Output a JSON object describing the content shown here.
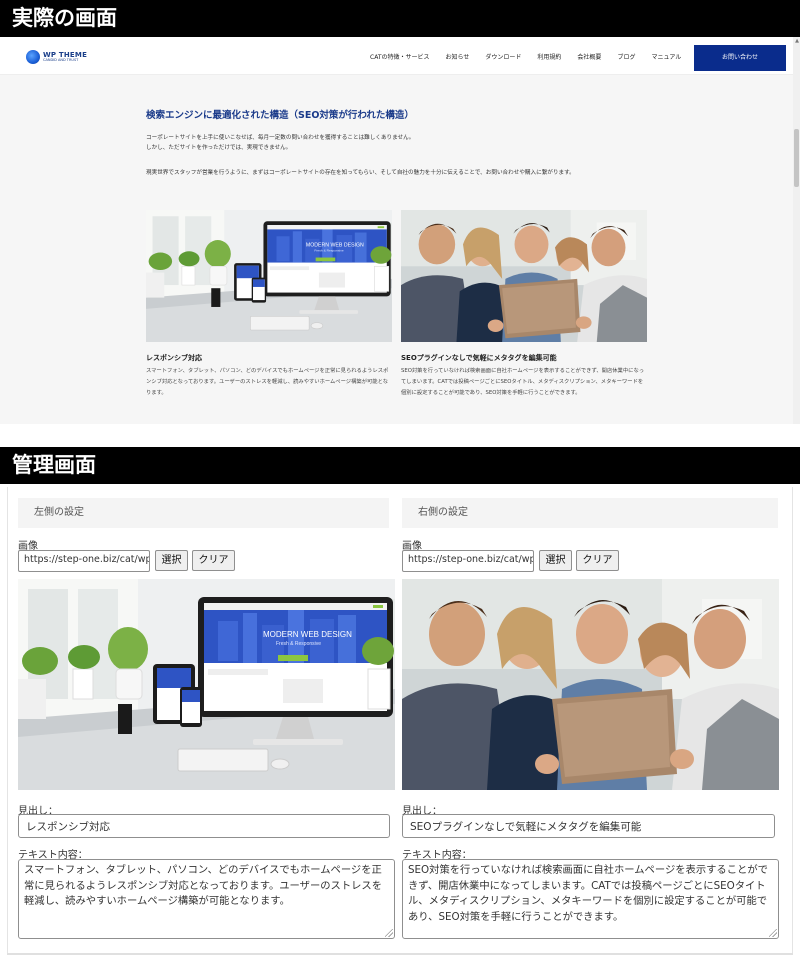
{
  "headings": {
    "actual": "実際の画面",
    "admin": "管理画面"
  },
  "site": {
    "logo_name": "WP THEME",
    "logo_sub": "CANDID AND TRUST",
    "nav": [
      "CATの特徴・サービス",
      "お知らせ",
      "ダウンロード",
      "利用規約",
      "会社概要",
      "ブログ",
      "マニュアル"
    ],
    "contact": "お問い合わせ",
    "title": "検索エンジンに最適化された構造（SEO対策が行われた構造）",
    "paragraphs": [
      "コーポレートサイトを上手に使いこなせば、毎月一定数の問い合わせを獲得することは難しくありません。",
      "しかし、ただサイトを作っただけでは、実現できません。",
      "現実世界でスタッフが営業を行うように、まずはコーポレートサイトの存在を知ってもらい、そして自社の魅力を十分に伝えることで、お問い合わせや購入に繋がります。"
    ],
    "cards": [
      {
        "heading": "レスポンシブ対応",
        "text": "スマートフォン、タブレット、パソコン、どのデバイスでもホームページを正常に見られるようレスポンシブ対応となっております。ユーザーのストレスを軽減し、読みやすいホームページ構築が可能となります。"
      },
      {
        "heading": "SEOプラグインなしで気軽にメタタグを編集可能",
        "text": "SEO対策を行っていなければ検索画面に自社ホームページを表示することができず、開店休業中になってしまいます。CATでは投稿ページごとにSEOタイトル、メタディスクリプション、メタキーワードを個別に設定することが可能であり、SEO対策を手軽に行うことができます。"
      }
    ],
    "mock_screen": {
      "title": "MODERN WEB DESIGN",
      "subtitle": "Fresh & Responsive"
    }
  },
  "admin": {
    "left": {
      "section": "左側の設定",
      "image_label": "画像",
      "image_url": "https://step-one.biz/cat/wp-content/uploads/responsive.jpg",
      "select_button": "選択",
      "clear_button": "クリア",
      "heading_label": "見出し：",
      "heading_value": "レスポンシブ対応",
      "text_label": "テキスト内容：",
      "text_value": "スマートフォン、タブレット、パソコン、どのデバイスでもホームページを正常に見られるようレスポンシブ対応となっております。ユーザーのストレスを軽減し、読みやすいホームページ構築が可能となります。"
    },
    "right": {
      "section": "右側の設定",
      "image_label": "画像",
      "image_url": "https://step-one.biz/cat/wp-content/uploads/seo.jpg",
      "select_button": "選択",
      "clear_button": "クリア",
      "heading_label": "見出し：",
      "heading_value": "SEOプラグインなしで気軽にメタタグを編集可能",
      "text_label": "テキスト内容：",
      "text_value": "SEO対策を行っていなければ検索画面に自社ホームページを表示することができず、開店休業中になってしまいます。CATでは投稿ページごとにSEOタイトル、メタディスクリプション、メタキーワードを個別に設定することが可能であり、SEO対策を手軽に行うことができます。"
    }
  },
  "colors": {
    "brand_navy": "#0a2c8c",
    "title_blue": "#1a3a8a",
    "accent_green": "#8cc63f"
  }
}
